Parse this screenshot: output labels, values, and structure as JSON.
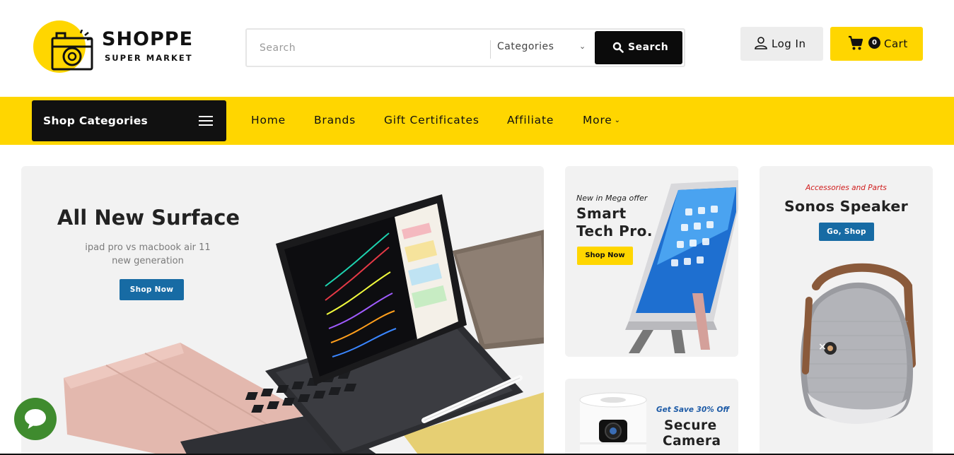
{
  "brand": {
    "name": "SHOPPE",
    "tagline": "SUPER MARKET",
    "accent_color": "#FFD600",
    "primary_button_color": "#176ba4"
  },
  "search": {
    "placeholder": "Search",
    "value": "",
    "category_selected": "Categories",
    "button_label": "Search"
  },
  "account": {
    "login_label": "Log In",
    "cart_label": "Cart",
    "cart_count": "0"
  },
  "nav": {
    "shop_categories_label": "Shop Categories",
    "items": [
      {
        "label": "Home"
      },
      {
        "label": "Brands"
      },
      {
        "label": "Gift Certificates"
      },
      {
        "label": "Affiliate"
      },
      {
        "label": "More"
      }
    ]
  },
  "banners": {
    "main": {
      "title": "All New Surface",
      "subtitle_line1": "ipad pro vs macbook air 11",
      "subtitle_line2": "new generation",
      "button": "Shop Now",
      "image": "ipad-keyboard-product-image"
    },
    "smart": {
      "tag": "New in Mega offer",
      "title_line1": "Smart",
      "title_line2": "Tech Pro.",
      "button": "Shop Now",
      "image": "tablet-stand-product-image"
    },
    "camera": {
      "tag": "Get Save 30% Off",
      "title_line1": "Secure",
      "title_line2": "Camera",
      "image": "security-camera-product-image"
    },
    "sonos": {
      "tag": "Accessories and Parts",
      "title": "Sonos Speaker",
      "button": "Go, Shop",
      "image": "speaker-product-image"
    }
  },
  "icons": {
    "logo": "camera-logo-icon",
    "search": "search-icon",
    "user": "user-icon",
    "cart": "cart-icon",
    "menu": "hamburger-menu-icon",
    "chat": "chat-icon"
  }
}
